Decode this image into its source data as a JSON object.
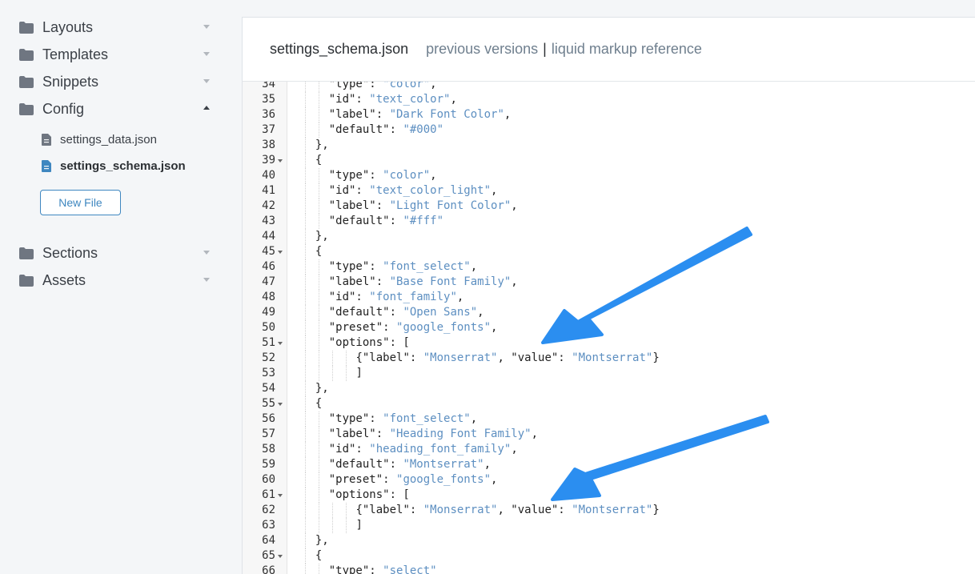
{
  "sidebar": {
    "folders_top": [
      {
        "label": "Layouts",
        "icon": "folder-icon",
        "expanded": false
      },
      {
        "label": "Templates",
        "icon": "folder-icon",
        "expanded": false
      },
      {
        "label": "Snippets",
        "icon": "folder-icon",
        "expanded": false
      },
      {
        "label": "Config",
        "icon": "folder-icon",
        "expanded": true
      }
    ],
    "config_files": [
      {
        "label": "settings_data.json",
        "active": false
      },
      {
        "label": "settings_schema.json",
        "active": true
      }
    ],
    "new_file_label": "New File",
    "folders_bottom": [
      {
        "label": "Sections",
        "icon": "folder-icon",
        "expanded": false
      },
      {
        "label": "Assets",
        "icon": "folder-icon",
        "expanded": false
      }
    ]
  },
  "editor": {
    "file_title": "settings_schema.json",
    "link_previous": "previous versions",
    "separator": "|",
    "link_reference": "liquid markup reference",
    "lines": [
      {
        "n": "34",
        "fold": false,
        "ind": 4,
        "toks": [
          [
            "p",
            "\"type\": "
          ],
          [
            "s",
            "\"color\""
          ],
          [
            "p",
            ","
          ]
        ]
      },
      {
        "n": "35",
        "fold": false,
        "ind": 4,
        "toks": [
          [
            "p",
            "\"id\": "
          ],
          [
            "s",
            "\"text_color\""
          ],
          [
            "p",
            ","
          ]
        ]
      },
      {
        "n": "36",
        "fold": false,
        "ind": 4,
        "toks": [
          [
            "p",
            "\"label\": "
          ],
          [
            "s",
            "\"Dark Font Color\""
          ],
          [
            "p",
            ","
          ]
        ]
      },
      {
        "n": "37",
        "fold": false,
        "ind": 4,
        "toks": [
          [
            "p",
            "\"default\": "
          ],
          [
            "s",
            "\"#000\""
          ]
        ]
      },
      {
        "n": "38",
        "fold": false,
        "ind": 2,
        "toks": [
          [
            "p",
            "},"
          ]
        ]
      },
      {
        "n": "39",
        "fold": true,
        "ind": 2,
        "toks": [
          [
            "p",
            "{"
          ]
        ]
      },
      {
        "n": "40",
        "fold": false,
        "ind": 4,
        "toks": [
          [
            "p",
            "\"type\": "
          ],
          [
            "s",
            "\"color\""
          ],
          [
            "p",
            ","
          ]
        ]
      },
      {
        "n": "41",
        "fold": false,
        "ind": 4,
        "toks": [
          [
            "p",
            "\"id\": "
          ],
          [
            "s",
            "\"text_color_light\""
          ],
          [
            "p",
            ","
          ]
        ]
      },
      {
        "n": "42",
        "fold": false,
        "ind": 4,
        "toks": [
          [
            "p",
            "\"label\": "
          ],
          [
            "s",
            "\"Light Font Color\""
          ],
          [
            "p",
            ","
          ]
        ]
      },
      {
        "n": "43",
        "fold": false,
        "ind": 4,
        "toks": [
          [
            "p",
            "\"default\": "
          ],
          [
            "s",
            "\"#fff\""
          ]
        ]
      },
      {
        "n": "44",
        "fold": false,
        "ind": 2,
        "toks": [
          [
            "p",
            "},"
          ]
        ]
      },
      {
        "n": "45",
        "fold": true,
        "ind": 2,
        "toks": [
          [
            "p",
            "{"
          ]
        ]
      },
      {
        "n": "46",
        "fold": false,
        "ind": 4,
        "toks": [
          [
            "p",
            "\"type\": "
          ],
          [
            "s",
            "\"font_select\""
          ],
          [
            "p",
            ","
          ]
        ]
      },
      {
        "n": "47",
        "fold": false,
        "ind": 4,
        "toks": [
          [
            "p",
            "\"label\": "
          ],
          [
            "s",
            "\"Base Font Family\""
          ],
          [
            "p",
            ","
          ]
        ]
      },
      {
        "n": "48",
        "fold": false,
        "ind": 4,
        "toks": [
          [
            "p",
            "\"id\": "
          ],
          [
            "s",
            "\"font_family\""
          ],
          [
            "p",
            ","
          ]
        ]
      },
      {
        "n": "49",
        "fold": false,
        "ind": 4,
        "toks": [
          [
            "p",
            "\"default\": "
          ],
          [
            "s",
            "\"Open Sans\""
          ],
          [
            "p",
            ","
          ]
        ]
      },
      {
        "n": "50",
        "fold": false,
        "ind": 4,
        "toks": [
          [
            "p",
            "\"preset\": "
          ],
          [
            "s",
            "\"google_fonts\""
          ],
          [
            "p",
            ","
          ]
        ]
      },
      {
        "n": "51",
        "fold": true,
        "ind": 4,
        "toks": [
          [
            "p",
            "\"options\": ["
          ]
        ]
      },
      {
        "n": "52",
        "fold": false,
        "ind": 8,
        "toks": [
          [
            "p",
            "{\"label\": "
          ],
          [
            "s",
            "\"Monserrat\""
          ],
          [
            "p",
            ", \"value\": "
          ],
          [
            "s",
            "\"Montserrat\""
          ],
          [
            "p",
            "}"
          ]
        ]
      },
      {
        "n": "53",
        "fold": false,
        "ind": 8,
        "toks": [
          [
            "p",
            "]"
          ]
        ]
      },
      {
        "n": "54",
        "fold": false,
        "ind": 2,
        "toks": [
          [
            "p",
            "},"
          ]
        ]
      },
      {
        "n": "55",
        "fold": true,
        "ind": 2,
        "toks": [
          [
            "p",
            "{"
          ]
        ]
      },
      {
        "n": "56",
        "fold": false,
        "ind": 4,
        "toks": [
          [
            "p",
            "\"type\": "
          ],
          [
            "s",
            "\"font_select\""
          ],
          [
            "p",
            ","
          ]
        ]
      },
      {
        "n": "57",
        "fold": false,
        "ind": 4,
        "toks": [
          [
            "p",
            "\"label\": "
          ],
          [
            "s",
            "\"Heading Font Family\""
          ],
          [
            "p",
            ","
          ]
        ]
      },
      {
        "n": "58",
        "fold": false,
        "ind": 4,
        "toks": [
          [
            "p",
            "\"id\": "
          ],
          [
            "s",
            "\"heading_font_family\""
          ],
          [
            "p",
            ","
          ]
        ]
      },
      {
        "n": "59",
        "fold": false,
        "ind": 4,
        "toks": [
          [
            "p",
            "\"default\": "
          ],
          [
            "s",
            "\"Montserrat\""
          ],
          [
            "p",
            ","
          ]
        ]
      },
      {
        "n": "60",
        "fold": false,
        "ind": 4,
        "toks": [
          [
            "p",
            "\"preset\": "
          ],
          [
            "s",
            "\"google_fonts\""
          ],
          [
            "p",
            ","
          ]
        ]
      },
      {
        "n": "61",
        "fold": true,
        "ind": 4,
        "toks": [
          [
            "p",
            "\"options\": ["
          ]
        ]
      },
      {
        "n": "62",
        "fold": false,
        "ind": 8,
        "toks": [
          [
            "p",
            "{\"label\": "
          ],
          [
            "s",
            "\"Monserrat\""
          ],
          [
            "p",
            ", \"value\": "
          ],
          [
            "s",
            "\"Montserrat\""
          ],
          [
            "p",
            "}"
          ]
        ]
      },
      {
        "n": "63",
        "fold": false,
        "ind": 8,
        "toks": [
          [
            "p",
            "]"
          ]
        ]
      },
      {
        "n": "64",
        "fold": false,
        "ind": 2,
        "toks": [
          [
            "p",
            "},"
          ]
        ]
      },
      {
        "n": "65",
        "fold": true,
        "ind": 2,
        "toks": [
          [
            "p",
            "{"
          ]
        ]
      },
      {
        "n": "66",
        "fold": false,
        "ind": 4,
        "toks": [
          [
            "p",
            "\"type\": "
          ],
          [
            "s",
            "\"select\""
          ]
        ]
      }
    ]
  },
  "colors": {
    "string": "#5d8fc1",
    "accent": "#3f87c0",
    "arrow": "#2b8ef0"
  }
}
